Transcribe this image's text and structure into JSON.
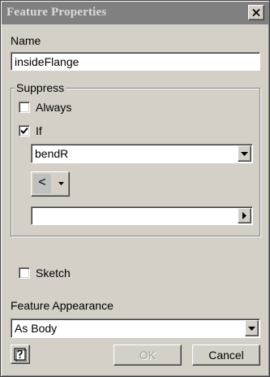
{
  "window": {
    "title": "Feature Properties"
  },
  "name_field": {
    "label": "Name",
    "value": "insideFlange"
  },
  "suppress": {
    "group_label": "Suppress",
    "always": {
      "label": "Always",
      "checked": false
    },
    "if": {
      "label": "If",
      "checked": true
    },
    "parameter": {
      "value": "bendR"
    },
    "operator": {
      "value": "<"
    },
    "compare_value": {
      "value": ""
    }
  },
  "sketch": {
    "label": "Sketch",
    "checked": false
  },
  "appearance": {
    "label": "Feature Appearance",
    "value": "As Body"
  },
  "buttons": {
    "ok": "OK",
    "cancel": "Cancel"
  },
  "icons": {
    "close": "close-icon",
    "dropdown": "chevron-down-icon",
    "expand": "chevron-right-icon",
    "help": "help-icon",
    "check": "checkmark-icon"
  },
  "colors": {
    "titlebar": "#808080",
    "face": "#d4d0c8"
  }
}
